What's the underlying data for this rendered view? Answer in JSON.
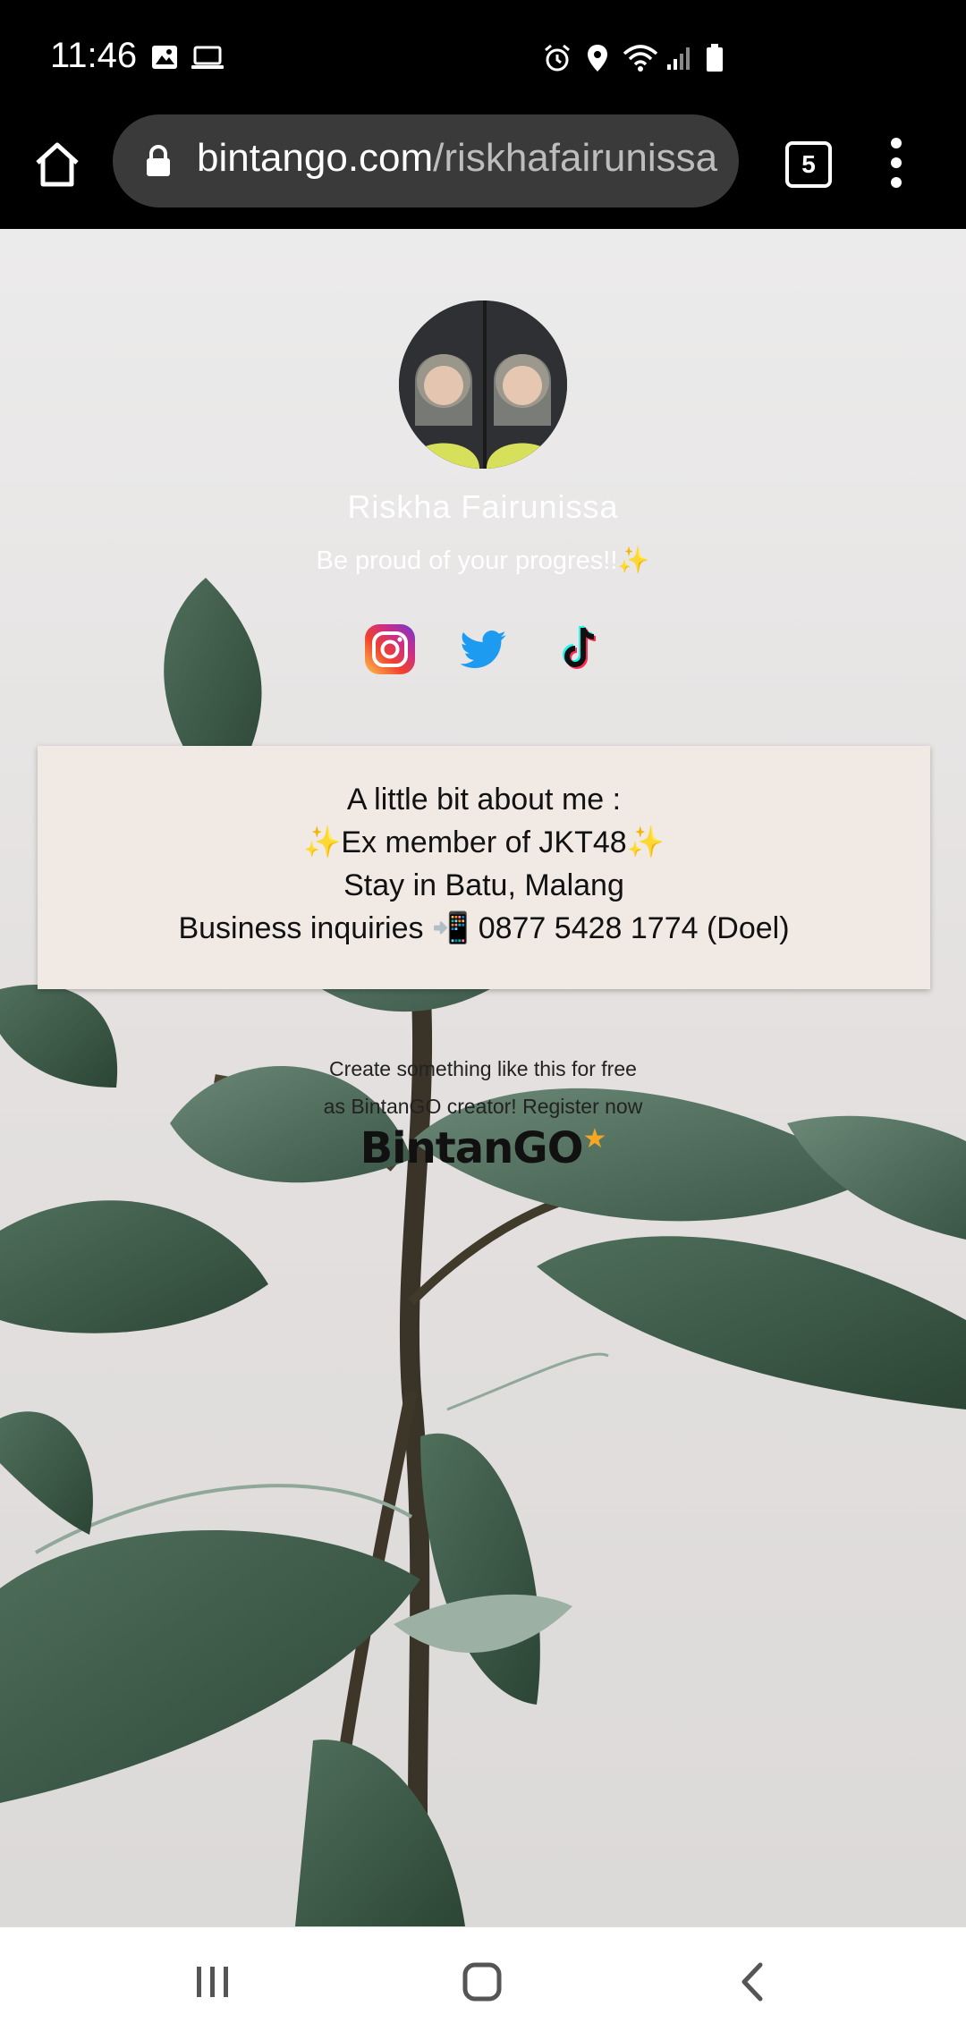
{
  "status_bar": {
    "time": "11:46"
  },
  "browser": {
    "url_domain": "bintango.com",
    "url_path": "/riskhafairunissa",
    "tab_count": "5"
  },
  "profile": {
    "name": "Riskha Fairunissa",
    "bio": "Be proud of your progres!!✨"
  },
  "socials": [
    {
      "name": "instagram",
      "icon": "instagram-icon"
    },
    {
      "name": "twitter",
      "icon": "twitter-icon"
    },
    {
      "name": "tiktok",
      "icon": "tiktok-icon"
    }
  ],
  "about": {
    "lines": [
      "A little bit about me :",
      "✨Ex member of JKT48✨",
      "Stay in Batu, Malang",
      "Business inquiries 📲 0877 5428 1774 (Doel)"
    ]
  },
  "promo": {
    "line1": "Create something like this for free",
    "line2": "as BintanGO creator! Register now",
    "logo": "BintanGO"
  },
  "colors": {
    "status_bg": "#000000",
    "url_bar_bg": "#3a3a3a",
    "card_bg": "#f0e9e4",
    "leaf_green": "#3e5c4a"
  }
}
